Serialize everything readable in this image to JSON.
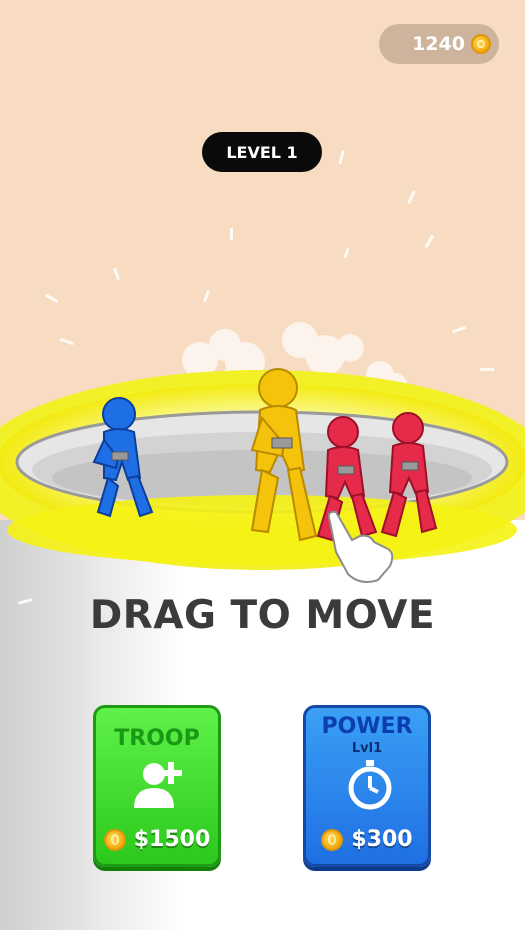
{
  "hud": {
    "coins": "1240",
    "level_label": "LEVEL 1"
  },
  "instruction": "DRAG TO MOVE",
  "cards": {
    "troop": {
      "title": "TROOP",
      "price": "$1500"
    },
    "power": {
      "title": "POWER",
      "level": "Lvl1",
      "price": "$300"
    }
  },
  "icons": {
    "coin": "coin-icon",
    "troop": "add-user-icon",
    "power": "stopwatch-icon",
    "hand": "pointer-hand-icon"
  },
  "colors": {
    "background": "#f7dcc2",
    "arena_ring": "#f5f020",
    "troop_card": "#3fdc2c",
    "power_card": "#2a86ec",
    "blue_fighter": "#1e6ee6",
    "yellow_fighter": "#f5c20c",
    "red_fighter": "#e62a4a"
  }
}
